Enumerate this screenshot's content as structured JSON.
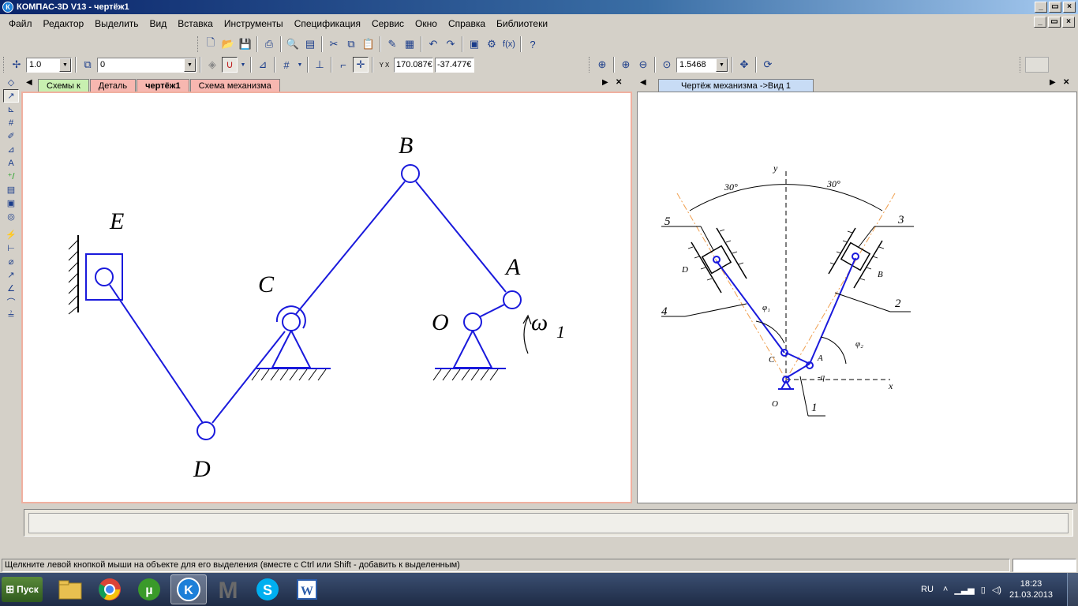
{
  "window": {
    "title": "КОМПАС-3D V13 - чертёж1",
    "icon": "К",
    "min": "_",
    "max": "□",
    "close": "×",
    "restore": "▭"
  },
  "menu": [
    "Файл",
    "Редактор",
    "Выделить",
    "Вид",
    "Вставка",
    "Инструменты",
    "Спецификация",
    "Сервис",
    "Окно",
    "Справка",
    "Библиотеки"
  ],
  "toolbar": {
    "step_value": "1.0",
    "layer_value": "0",
    "coord_x": "170.087€",
    "coord_y": "-37.477€",
    "zoom_value": "1.5468",
    "coord_label": "Y X"
  },
  "tabs_left": [
    {
      "label": "Схемы к",
      "color": "#c8f0b0"
    },
    {
      "label": "Деталь",
      "color": "#f7b7b0"
    },
    {
      "label": "чертёж1",
      "color": "#f7b7b0",
      "active": true
    },
    {
      "label": "Схема механизма",
      "color": "#f7b7b0"
    }
  ],
  "tabs_right": [
    {
      "label": "Чертёж механизма ->Вид 1",
      "color": "#c8dcf5",
      "active": true
    }
  ],
  "drawing_left": {
    "labels": {
      "E": "E",
      "B": "B",
      "C": "C",
      "A": "A",
      "O": "O",
      "D": "D",
      "omega": "ω",
      "omega_sub": "1"
    }
  },
  "drawing_right": {
    "labels": {
      "y": "y",
      "x": "x",
      "angle_left": "30°",
      "angle_right": "30°",
      "n5": "5",
      "n3": "3",
      "n4": "4",
      "n2": "2",
      "n1": "1",
      "D": "D",
      "B": "B",
      "C": "C",
      "A": "A",
      "O": "O",
      "phi1": "φ₁",
      "phi2": "φ₂",
      "minus_q": "-q"
    }
  },
  "status": {
    "text": "Щелкните левой кнопкой мыши на объекте для его выделения (вместе с Ctrl или Shift - добавить к выделенным)"
  },
  "taskbar": {
    "start": "Пуск",
    "lang": "RU",
    "time": "18:23",
    "date": "21.03.2013"
  },
  "colors": {
    "line": "#1a1adc",
    "axis": "#000000",
    "orange": "#f0a050"
  }
}
